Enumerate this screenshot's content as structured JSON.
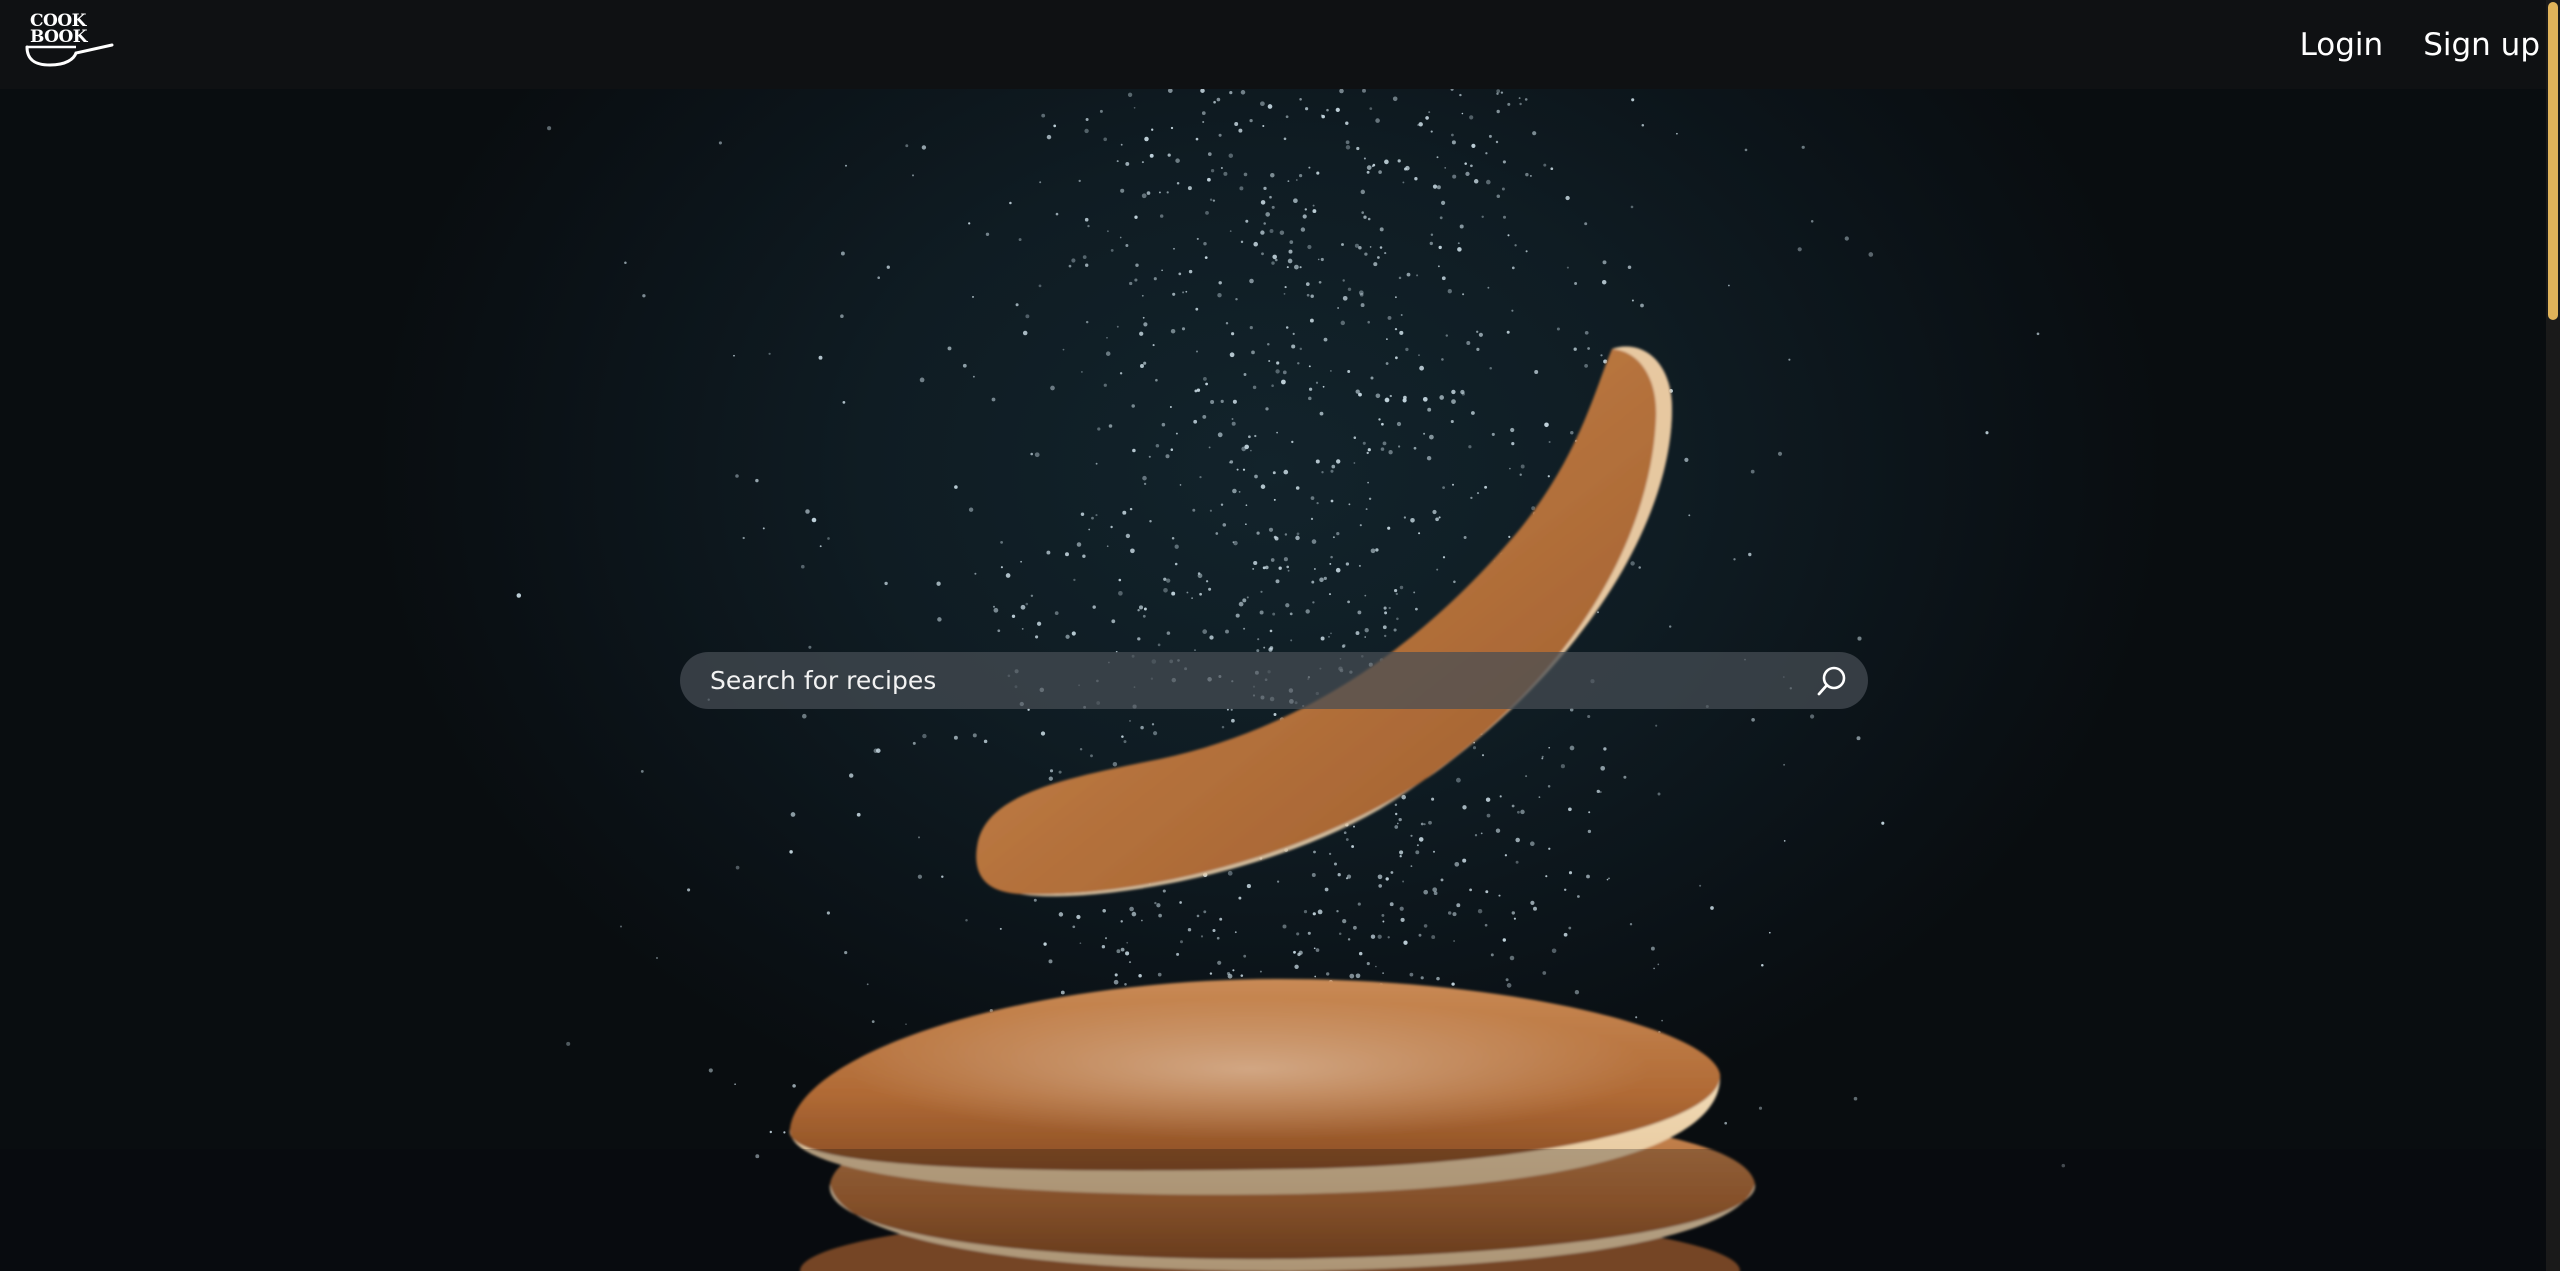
{
  "header": {
    "logo_text": "COOK\nBOOK",
    "nav": {
      "login_label": "Login",
      "signup_label": "Sign up"
    }
  },
  "search": {
    "placeholder": "Search for recipes",
    "value": "",
    "icon": "search-icon"
  },
  "hero": {
    "image": "pancakes-dusted-with-powdered-sugar"
  },
  "colors": {
    "header_bg": "#0f1113",
    "accent": "#e0b35a",
    "search_bg": "rgba(70,78,84,0.72)"
  }
}
